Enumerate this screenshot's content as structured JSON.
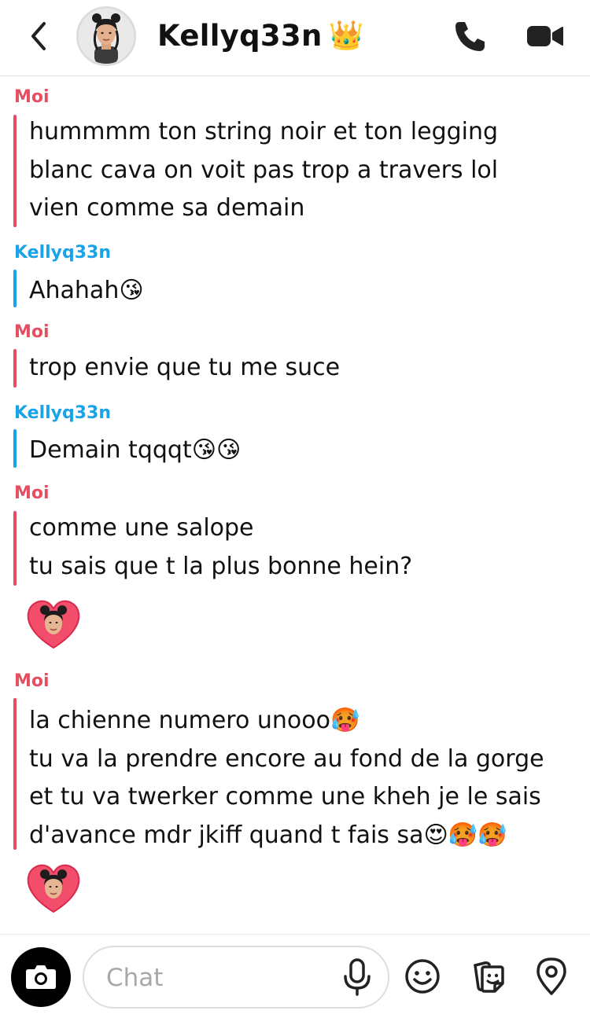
{
  "header": {
    "title": "Kellyq33n",
    "title_badge": "👑",
    "back_icon": "chevron-left-icon",
    "call_icon": "phone-icon",
    "video_icon": "video-camera-icon"
  },
  "colors": {
    "me": "#e44e60",
    "her": "#1aa3e8"
  },
  "messages": [
    {
      "sender": "Moi",
      "lines": [
        "hummmm ton string noir et ton legging",
        "blanc cava on voit pas trop a travers lol",
        "vien comme sa demain"
      ]
    },
    {
      "sender": "Kellyq33n",
      "lines": [
        "Ahahah😘"
      ]
    },
    {
      "sender": "Moi",
      "lines": [
        "trop envie que tu me suce"
      ]
    },
    {
      "sender": "Kellyq33n",
      "lines": [
        "Demain tqqqt😘😘"
      ]
    },
    {
      "sender": "Moi",
      "lines": [
        "comme une salope",
        "tu sais que t la plus bonne hein?"
      ],
      "reaction": "bitmoji-heart-icon"
    },
    {
      "sender": "Moi",
      "lines": [
        "la chienne numero unooo🥵",
        "tu va la prendre encore au fond de la gorge",
        "et tu va twerker comme une kheh je le sais",
        "d'avance mdr jkiff quand t fais sa😍🥵🥵"
      ],
      "reaction": "bitmoji-heart-icon"
    }
  ],
  "footer": {
    "placeholder": "Chat",
    "camera_icon": "camera-icon",
    "mic_icon": "microphone-icon",
    "emoji_icon": "smiley-icon",
    "sticker_icon": "sticker-icon",
    "map_icon": "map-pin-icon"
  }
}
